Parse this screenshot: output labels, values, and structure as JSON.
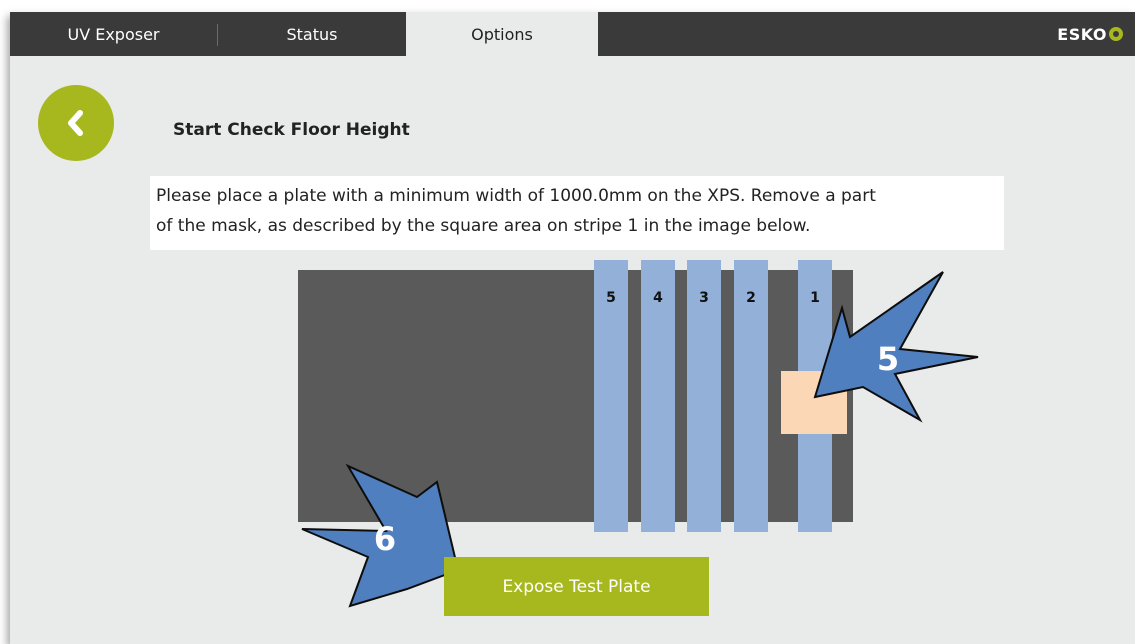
{
  "tabs": [
    {
      "label": "UV Exposer",
      "active": false
    },
    {
      "label": "Status",
      "active": false
    },
    {
      "label": "Options",
      "active": true
    }
  ],
  "brand": {
    "name": "ESKO"
  },
  "page": {
    "title": "Start Check Floor Height"
  },
  "instructions": {
    "line1": "Please place a plate with a minimum width of 1000.0mm on the XPS. Remove a part",
    "line2": "of the mask, as described by the square area on stripe 1 in the image below."
  },
  "diagram": {
    "stripes": [
      "5",
      "4",
      "3",
      "2",
      "1"
    ],
    "callouts": {
      "mask_area": "5",
      "expose_button": "6"
    }
  },
  "actions": {
    "expose_label": "Expose Test Plate"
  },
  "colors": {
    "accent": "#a7b81f",
    "tabbar": "#3a3a3a",
    "background": "#e9eaea",
    "plate": "#5a5a5a",
    "stripe": "#92b0d8",
    "mask_square": "#fcd7b6",
    "arrow": "#4f7fbe"
  }
}
